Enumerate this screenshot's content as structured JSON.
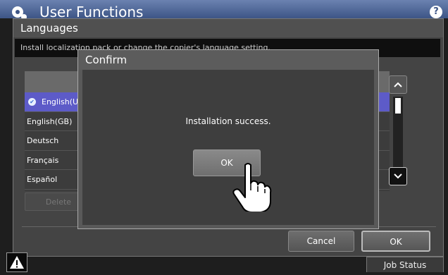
{
  "app": {
    "title": "User Functions",
    "help_label": "?"
  },
  "window": {
    "title": "Languages",
    "description": "Install localization pack or change the copier's language setting."
  },
  "languages": [
    {
      "label": "English(US)",
      "selected": true
    },
    {
      "label": "English(GB)"
    },
    {
      "label": "Deutsch"
    },
    {
      "label": "Français"
    },
    {
      "label": "Español"
    }
  ],
  "buttons": {
    "delete": "Delete",
    "cancel": "Cancel",
    "ok": "OK"
  },
  "status": {
    "job_status": "Job Status",
    "warning_icon": "warning-icon"
  },
  "dialog": {
    "title": "Confirm",
    "message": "Installation success.",
    "ok": "OK"
  },
  "colors": {
    "selected_row": "#5d5bc8",
    "titlebar": "#3d5586"
  }
}
